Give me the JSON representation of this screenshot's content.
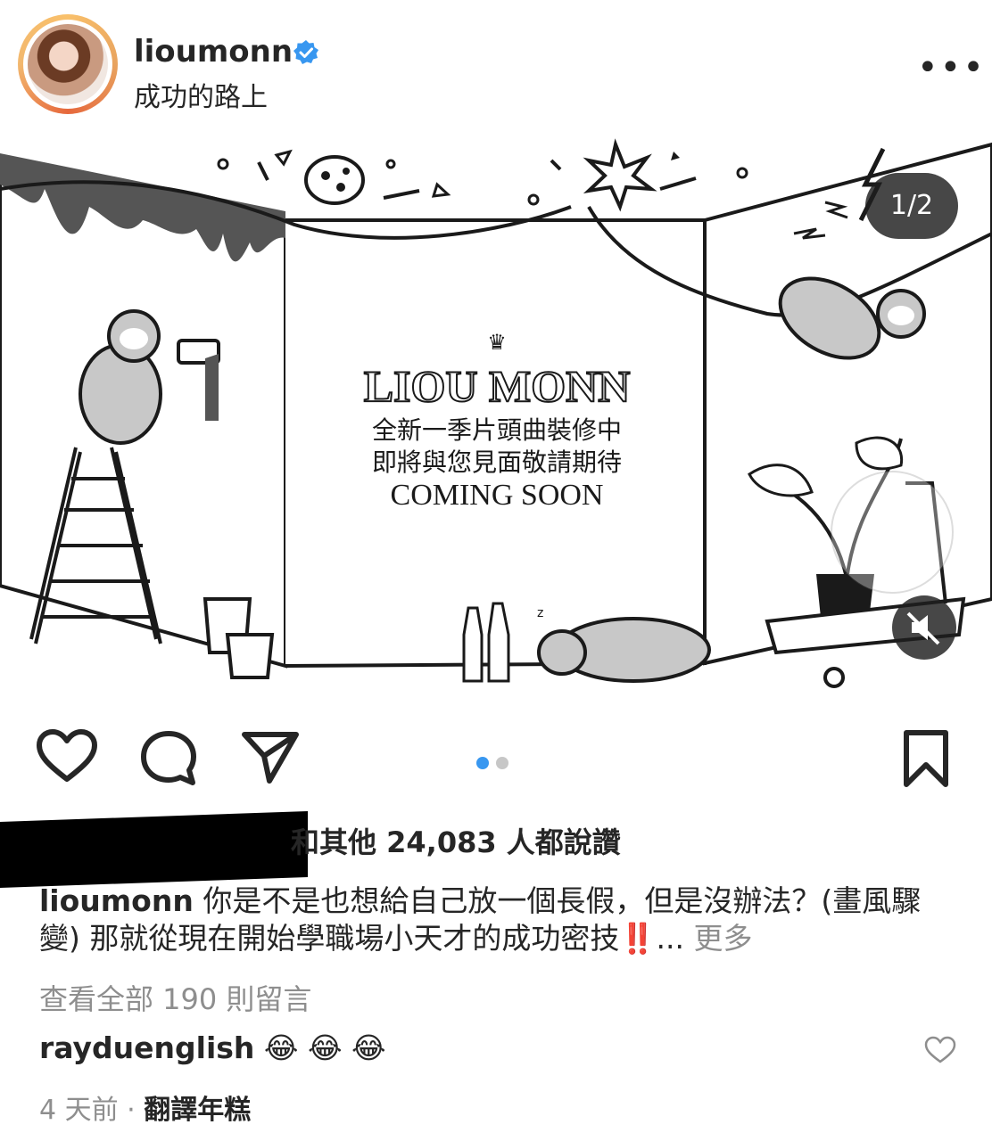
{
  "header": {
    "username": "lioumonn",
    "subtitle": "成功的路上",
    "more": "•••"
  },
  "media": {
    "counter": "1/2",
    "poster_title": "LIOU MONN",
    "poster_line1": "全新一季片頭曲裝修中",
    "poster_line2": "即將與您見面敬請期待",
    "poster_line3": "COMING SOON",
    "colors": {
      "line": "#1a1a1a",
      "sloth": "#c8c8c8",
      "paint": "#555555"
    }
  },
  "actions": {
    "carousel_active_color": "#3897f0",
    "carousel_inactive_color": "#c7c7c7"
  },
  "likes": {
    "text": "和其他 24,083 人都說讚"
  },
  "caption": {
    "username": "lioumonn",
    "text": "你是不是也想給自己放一個長假，但是沒辦法？(畫風驟變) 那就從現在開始學職場小天才的成功密技",
    "emoji": "‼️",
    "ellipsis": "... ",
    "more": "更多"
  },
  "comments": {
    "view_all": "查看全部 190 則留言",
    "first": {
      "username": "rayduenglish",
      "text": "😂 😂 😂"
    }
  },
  "meta": {
    "time": "4 天前",
    "dot": " · ",
    "translate": "翻譯年糕"
  }
}
